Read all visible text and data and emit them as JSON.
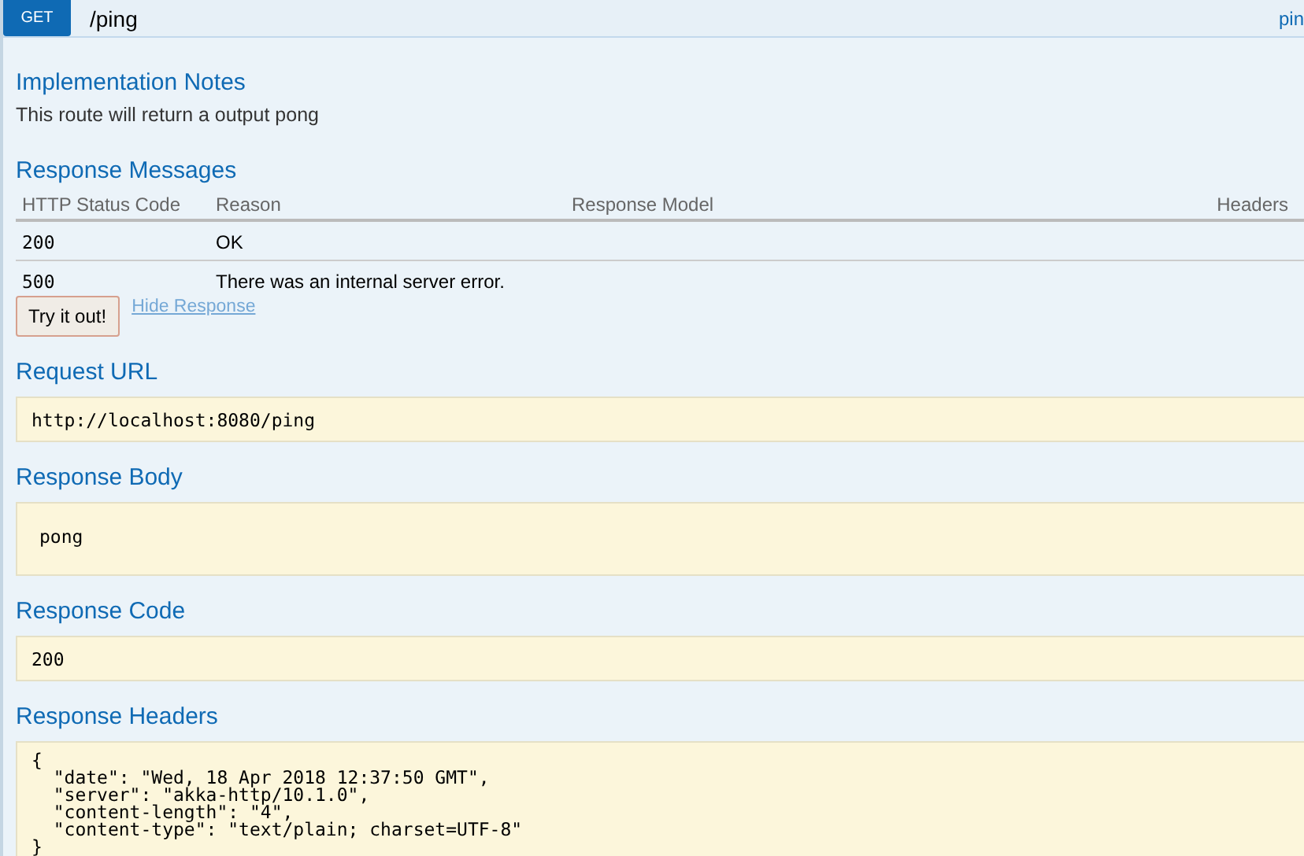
{
  "endpoint": {
    "method": "GET",
    "path": "/ping",
    "tag": "pin"
  },
  "implementation_notes": {
    "title": "Implementation Notes",
    "text": "This route will return a output pong"
  },
  "response_messages": {
    "title": "Response Messages",
    "columns": [
      "HTTP Status Code",
      "Reason",
      "Response Model",
      "Headers"
    ],
    "rows": [
      {
        "code": "200",
        "reason": "OK"
      },
      {
        "code": "500",
        "reason": "There was an internal server error."
      }
    ]
  },
  "try_button": "Try it out!",
  "hide_link": "Hide Response",
  "results": [
    {
      "title": "Request URL",
      "value": "http://localhost:8080/ping",
      "kind": "url"
    },
    {
      "title": "Response Body",
      "value": "pong",
      "kind": "body"
    },
    {
      "title": "Response Code",
      "value": "200",
      "kind": "code"
    },
    {
      "title": "Response Headers",
      "value": "{\n  \"date\": \"Wed, 18 Apr 2018 12:37:50 GMT\",\n  \"server\": \"akka-http/10.1.0\",\n  \"content-length\": \"4\",\n  \"content-type\": \"text/plain; charset=UTF-8\"\n}",
      "kind": "headers"
    }
  ]
}
